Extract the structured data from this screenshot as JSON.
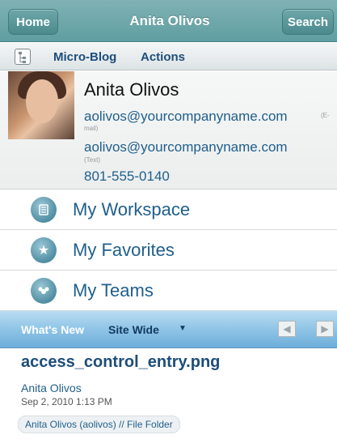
{
  "header": {
    "title": "Anita Olivos",
    "home_label": "Home",
    "search_label": "Search"
  },
  "toolbar": {
    "icon": "tree-icon",
    "links": [
      "Micro-Blog",
      "Actions"
    ]
  },
  "profile": {
    "name": "Anita Olivos",
    "email": "aolivos@yourcompanyname.com",
    "email_note_1": "(E-",
    "email_note_2": "mail)",
    "text": "aolivos@yourcompanyname.com",
    "text_note": "(Text)",
    "phone": "801-555-0140"
  },
  "menu": [
    {
      "label": "My Workspace",
      "icon": "workspace-icon"
    },
    {
      "label": "My Favorites",
      "icon": "star-icon"
    },
    {
      "label": "My Teams",
      "icon": "team-icon"
    }
  ],
  "whats_new": {
    "label": "What's New",
    "scope": "Site Wide",
    "prev_icon": "arrow-left-icon",
    "next_icon": "arrow-right-icon"
  },
  "feed": {
    "title": "access_control_entry.png",
    "author": "Anita Olivos",
    "date": "Sep 2, 2010 1:13 PM",
    "folder": "Anita Olivos (aolivos) // File Folder"
  }
}
